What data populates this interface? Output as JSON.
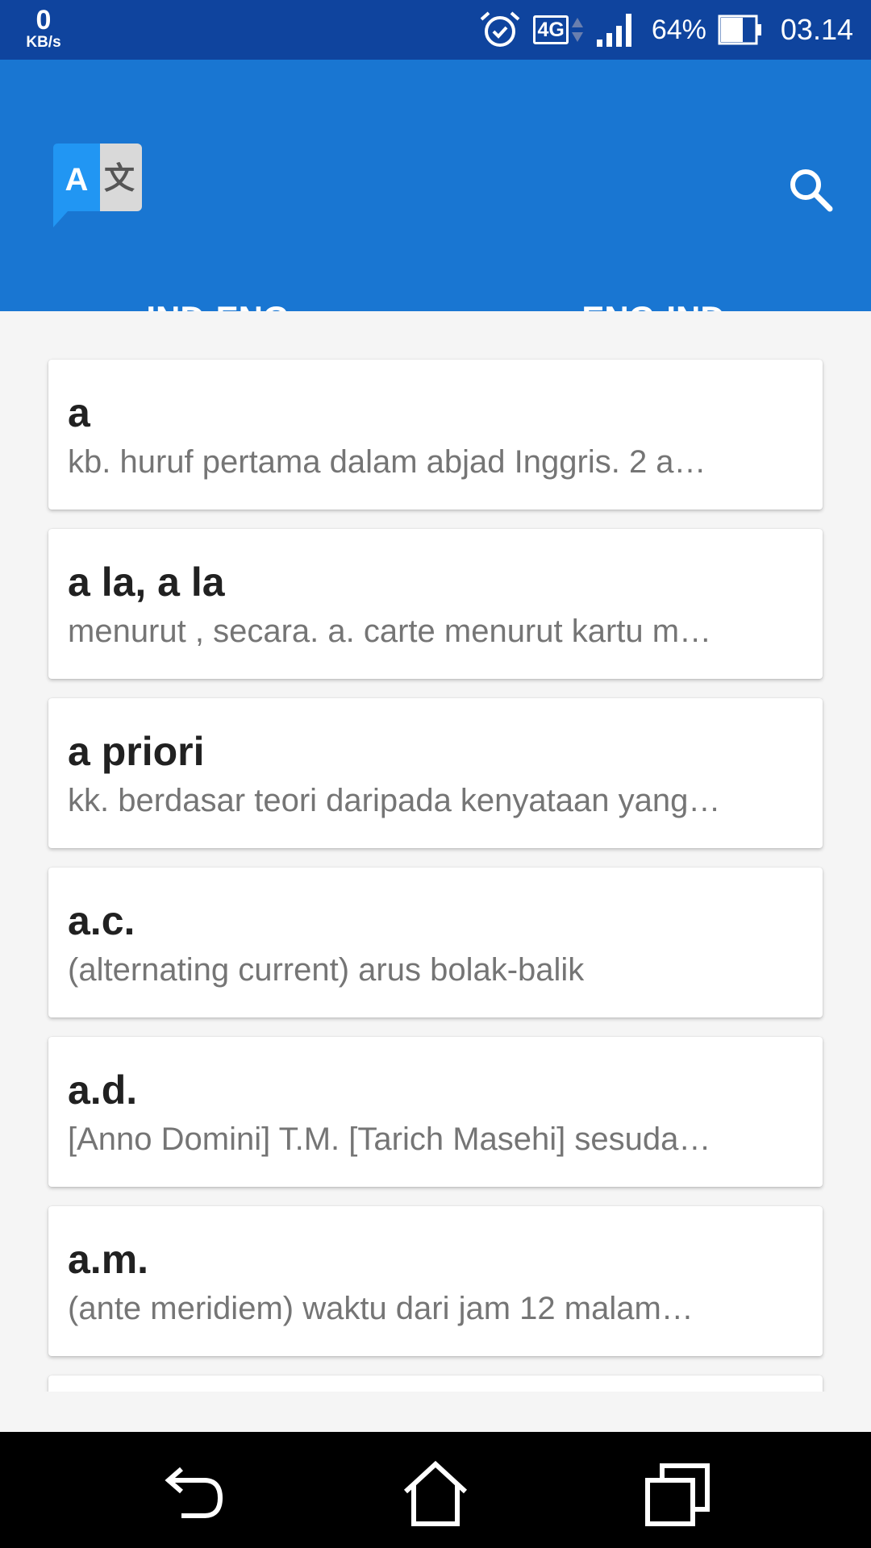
{
  "status_bar": {
    "net_speed_value": "0",
    "net_speed_unit": "KB/s",
    "network_type": "4G",
    "battery_percent": "64%",
    "battery_level": 0.64,
    "time": "03.14"
  },
  "app_bar": {
    "logo_icon": "translate-icon",
    "logo_letter_latin": "A",
    "logo_letter_cjk": "文",
    "search_icon": "search-icon"
  },
  "tabs": [
    {
      "label": "IND-ENG",
      "active": false
    },
    {
      "label": "ENG-IND",
      "active": true
    }
  ],
  "entries": [
    {
      "word": "a",
      "definition": "kb. huruf pertama dalam abjad Inggris. 2 a…"
    },
    {
      "word": "a la, a la",
      "definition": "menurut , secara. a. carte menurut kartu m…"
    },
    {
      "word": "a priori",
      "definition": "kk. berdasar teori daripada kenyataan yang…"
    },
    {
      "word": "a.c.",
      "definition": "(alternating current) arus bolak-balik"
    },
    {
      "word": "a.d.",
      "definition": "[Anno Domini] T.M. [Tarich Masehi] sesuda…"
    },
    {
      "word": "a.m.",
      "definition": "(ante meridiem) waktu dari jam 12 malam…"
    }
  ],
  "nav_bar": {
    "back_icon": "back-icon",
    "home_icon": "home-icon",
    "recents_icon": "recents-icon"
  },
  "colors": {
    "status_bar": "#0f449e",
    "app_bar": "#1976d2",
    "tab_indicator": "#ff9800",
    "background": "#f5f5f5"
  }
}
